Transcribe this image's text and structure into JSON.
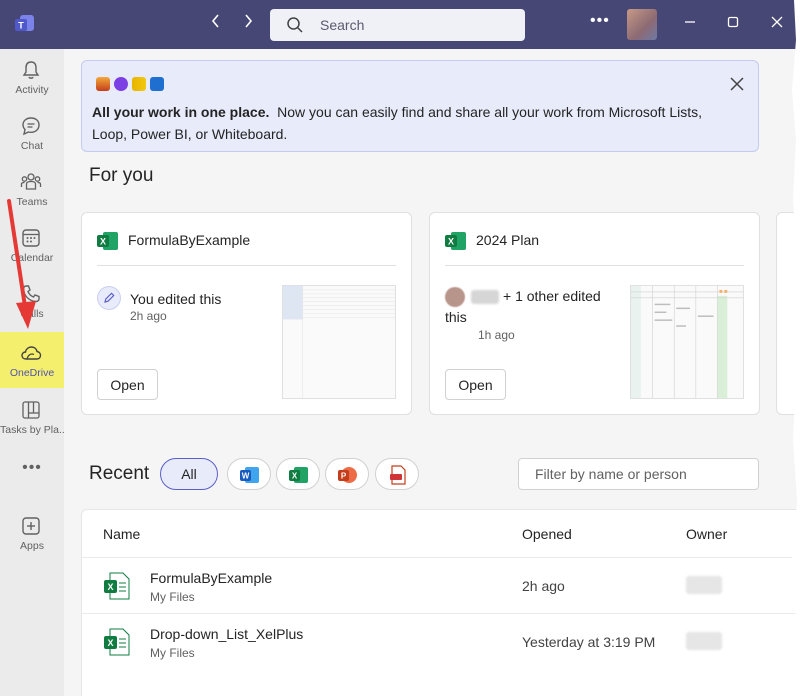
{
  "titlebar": {
    "search_placeholder": "Search",
    "back_icon": "chevron-left-icon",
    "forward_icon": "chevron-right-icon",
    "more_label": "•••"
  },
  "rail": {
    "items": [
      {
        "label": "Activity",
        "icon": "bell-icon"
      },
      {
        "label": "Chat",
        "icon": "chat-icon"
      },
      {
        "label": "Teams",
        "icon": "teams-icon"
      },
      {
        "label": "Calendar",
        "icon": "calendar-icon"
      },
      {
        "label": "Calls",
        "icon": "phone-icon"
      },
      {
        "label": "OneDrive",
        "icon": "cloud-icon"
      },
      {
        "label": "Tasks by Pla...",
        "icon": "planner-icon"
      },
      {
        "label": "Apps",
        "icon": "add-app-icon"
      }
    ],
    "more_label": "•••"
  },
  "banner": {
    "bold": "All your work in one place.",
    "text": "Now you can easily find and share all your work from Microsoft Lists, Loop, Power BI, or Whiteboard."
  },
  "for_you": {
    "title": "For you",
    "cards": [
      {
        "title": "FormulaByExample",
        "activity": "You edited this",
        "time": "2h ago",
        "open_label": "Open"
      },
      {
        "title": "2024 Plan",
        "activity": "+ 1 other edited this",
        "time": "1h ago",
        "open_label": "Open"
      }
    ]
  },
  "recent": {
    "title": "Recent",
    "filters": {
      "all": "All"
    },
    "filter_placeholder": "Filter by name or person",
    "columns": {
      "name": "Name",
      "opened": "Opened",
      "owner": "Owner"
    },
    "rows": [
      {
        "name": "FormulaByExample",
        "location": "My Files",
        "opened": "2h ago"
      },
      {
        "name": "Drop-down_List_XelPlus",
        "location": "My Files",
        "opened": "Yesterday at 3:19 PM"
      }
    ]
  },
  "colors": {
    "titlebar": "#464775",
    "accent": "#5b5fc7",
    "highlight": "#f5ef6e",
    "excel": "#107c41",
    "annotation_arrow": "#e53935"
  }
}
